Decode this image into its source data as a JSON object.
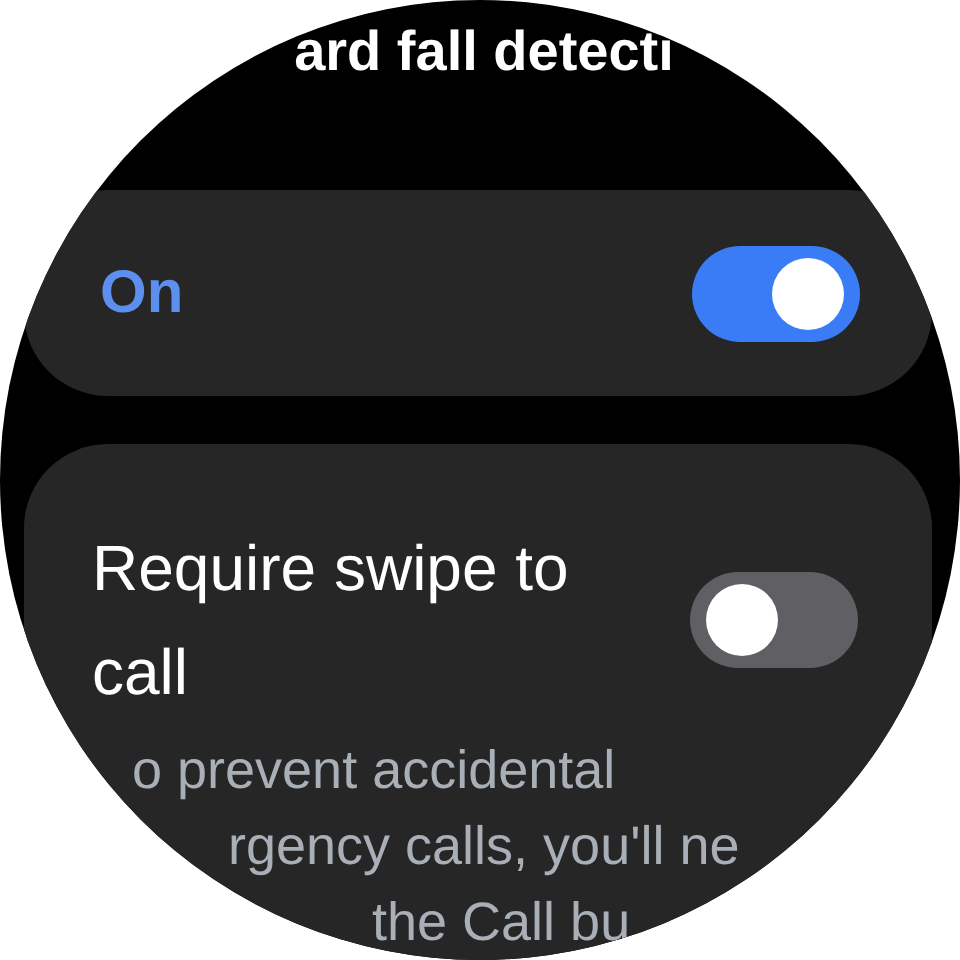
{
  "screen": {
    "title": "ard fall detecti"
  },
  "settings": [
    {
      "kind": "toggle",
      "label": "On",
      "on": true,
      "accent": true
    },
    {
      "kind": "toggle",
      "label": "Require swipe to call",
      "on": false,
      "accent": false,
      "description_lines": [
        "o prevent accidental",
        "rgency calls, you'll ne",
        "the Call bu"
      ]
    }
  ]
}
